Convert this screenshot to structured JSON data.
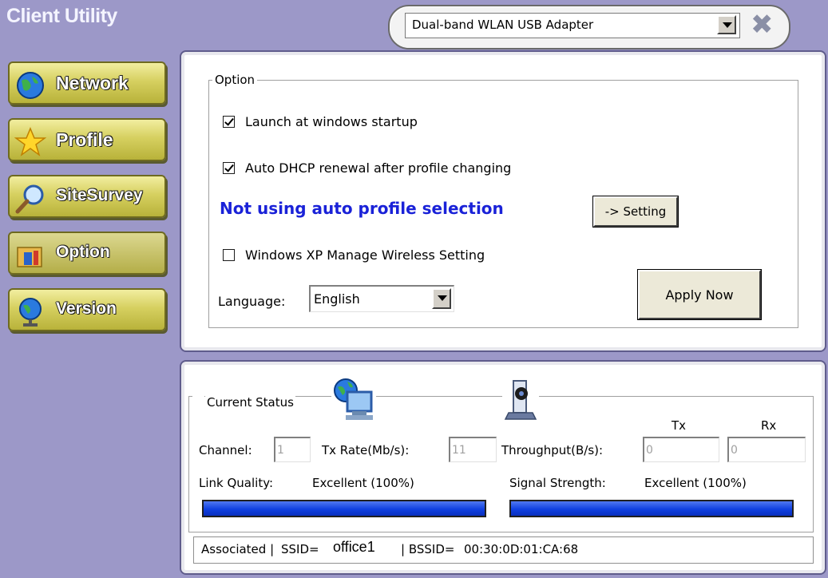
{
  "app": {
    "title": "Client Utility"
  },
  "adapter": {
    "selected": "Dual-band WLAN USB Adapter"
  },
  "sidebar": {
    "items": [
      {
        "label": "Network",
        "icon": "globe-icon"
      },
      {
        "label": "Profile",
        "icon": "star-icon"
      },
      {
        "label": "SiteSurvey",
        "icon": "magnifier-icon"
      },
      {
        "label": "Option",
        "icon": "folder-tools-icon"
      },
      {
        "label": "Version",
        "icon": "globe-stand-icon"
      }
    ],
    "active": "Option"
  },
  "option": {
    "group_label": "Option",
    "launch_startup": {
      "label": "Launch at windows startup",
      "checked": true
    },
    "auto_dhcp": {
      "label": "Auto DHCP renewal after profile changing",
      "checked": true
    },
    "auto_profile_status": "Not using auto profile selection",
    "setting_button": "-> Setting",
    "xp_manage": {
      "label": "Windows XP Manage Wireless Setting",
      "checked": false
    },
    "language_label": "Language:",
    "language_value": "English",
    "apply_button": "Apply Now"
  },
  "status": {
    "group_label": "Current Status",
    "tx_header": "Tx",
    "rx_header": "Rx",
    "channel_label": "Channel:",
    "channel_value": "1",
    "tx_rate_label": "Tx Rate(Mb/s):",
    "tx_rate_value": "11",
    "throughput_label": "Throughput(B/s):",
    "throughput_tx": "0",
    "throughput_rx": "0",
    "link_quality_label": "Link Quality:",
    "link_quality_value": "Excellent (100%)",
    "link_quality_percent": 100,
    "signal_strength_label": "Signal Strength:",
    "signal_strength_value": "Excellent (100%)",
    "signal_strength_percent": 100,
    "association": {
      "state": "Associated |",
      "ssid_label": "SSID=",
      "ssid": "office1",
      "bssid_label": "| BSSID=",
      "bssid": "00:30:0D:01:CA:68"
    }
  },
  "colors": {
    "background": "#9c98c8",
    "nav_button": "#d6d060",
    "status_text": "#1a22d8",
    "bar_fill": "#1040e0"
  }
}
